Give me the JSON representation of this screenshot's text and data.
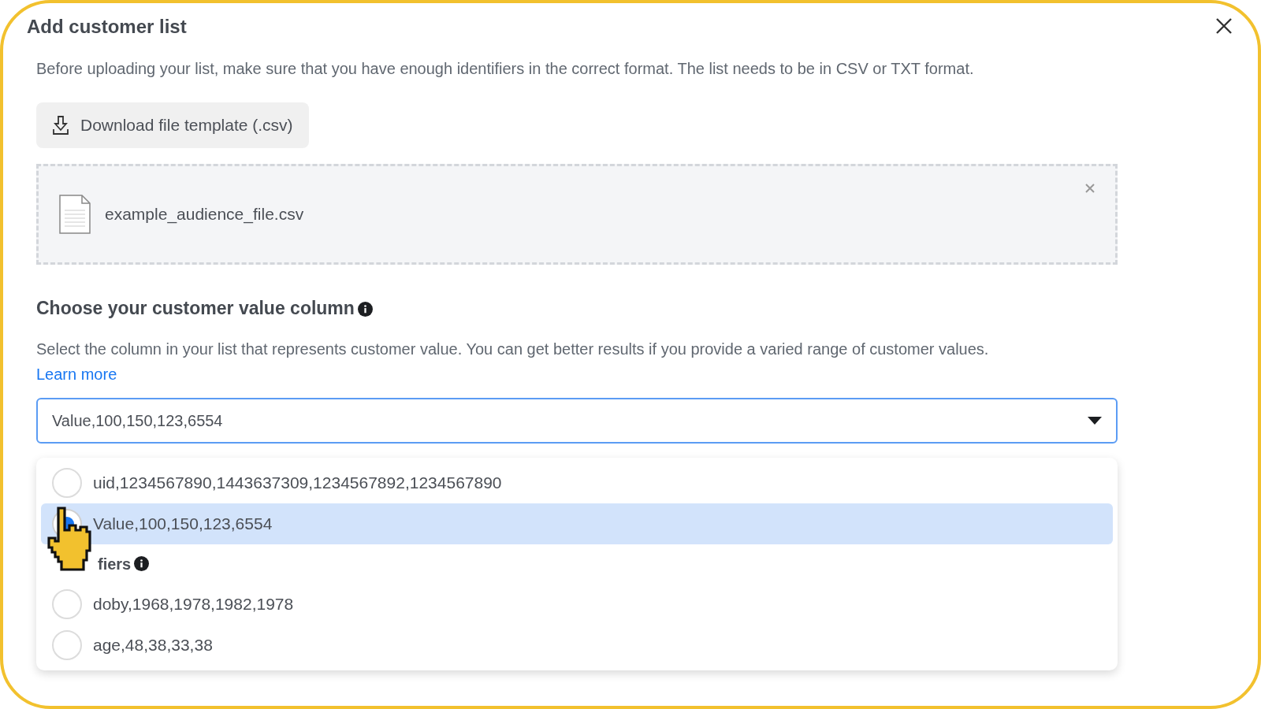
{
  "dialog": {
    "title": "Add customer list",
    "description": "Before uploading your list, make sure that you have enough identifiers in the correct format. The list needs to be in CSV or TXT format.",
    "download_button": "Download file template (.csv)",
    "file": {
      "name": "example_audience_file.csv"
    }
  },
  "section": {
    "heading": "Choose your customer value column",
    "description": "Select the column in your list that represents customer value. You can get better results if you provide a varied range of customer values.",
    "link": "Learn more"
  },
  "select": {
    "value": "Value,100,150,123,6554",
    "expanded": true
  },
  "options": [
    {
      "kind": "option",
      "label": "uid,1234567890,1443637309,1234567892,1234567890",
      "selected": false
    },
    {
      "kind": "option",
      "label": "Value,100,150,123,6554",
      "selected": true
    },
    {
      "kind": "header",
      "label": "fiers"
    },
    {
      "kind": "option",
      "label": "doby,1968,1978,1982,1978",
      "selected": false
    },
    {
      "kind": "option",
      "label": "age,48,38,33,38",
      "selected": false
    }
  ]
}
